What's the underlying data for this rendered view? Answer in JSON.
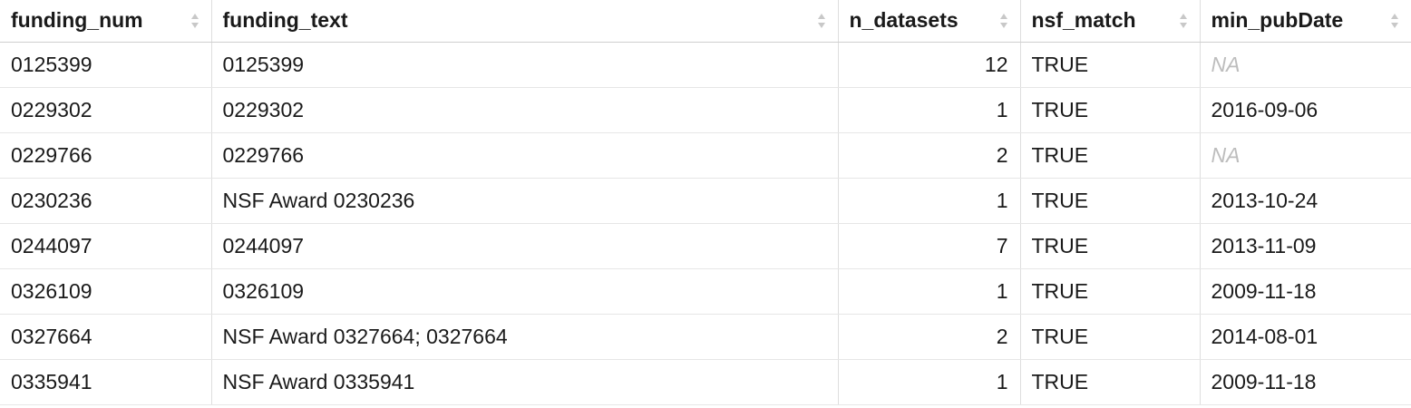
{
  "table": {
    "columns": [
      {
        "label": "funding_num"
      },
      {
        "label": "funding_text"
      },
      {
        "label": "n_datasets"
      },
      {
        "label": "nsf_match"
      },
      {
        "label": "min_pubDate"
      }
    ],
    "sort_icon": "sort-arrows-icon",
    "rows": [
      {
        "funding_num": "0125399",
        "funding_text": "0125399",
        "n_datasets": "12",
        "nsf_match": "TRUE",
        "min_pubDate": "NA"
      },
      {
        "funding_num": "0229302",
        "funding_text": "0229302",
        "n_datasets": "1",
        "nsf_match": "TRUE",
        "min_pubDate": "2016-09-06"
      },
      {
        "funding_num": "0229766",
        "funding_text": "0229766",
        "n_datasets": "2",
        "nsf_match": "TRUE",
        "min_pubDate": "NA"
      },
      {
        "funding_num": "0230236",
        "funding_text": "NSF Award 0230236",
        "n_datasets": "1",
        "nsf_match": "TRUE",
        "min_pubDate": "2013-10-24"
      },
      {
        "funding_num": "0244097",
        "funding_text": "0244097",
        "n_datasets": "7",
        "nsf_match": "TRUE",
        "min_pubDate": "2013-11-09"
      },
      {
        "funding_num": "0326109",
        "funding_text": "0326109",
        "n_datasets": "1",
        "nsf_match": "TRUE",
        "min_pubDate": "2009-11-18"
      },
      {
        "funding_num": "0327664",
        "funding_text": "NSF Award 0327664; 0327664",
        "n_datasets": "2",
        "nsf_match": "TRUE",
        "min_pubDate": "2014-08-01"
      },
      {
        "funding_num": "0335941",
        "funding_text": "NSF Award 0335941",
        "n_datasets": "1",
        "nsf_match": "TRUE",
        "min_pubDate": "2009-11-18"
      }
    ],
    "colors": {
      "na_text": "#bdbdbd",
      "sort_icon": "#c8c8c8",
      "border": "#dedede"
    }
  }
}
